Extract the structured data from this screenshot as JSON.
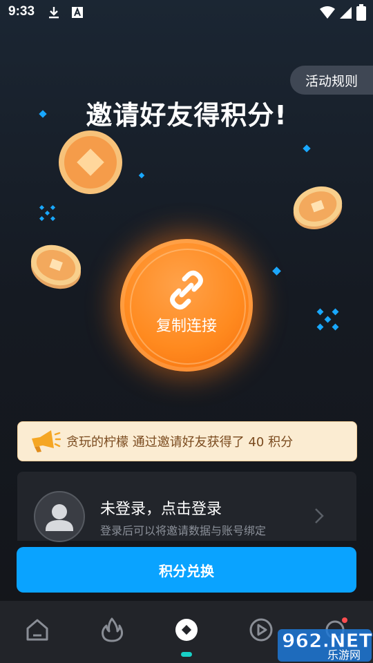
{
  "status_bar": {
    "time": "9:33"
  },
  "page": {
    "rules_label": "活动规则",
    "headline": "邀请好友得积分!",
    "copy_button_label": "复制连接"
  },
  "notice": {
    "text": "贪玩的柠檬 通过邀请好友获得了 40 积分"
  },
  "login": {
    "title": "未登录，点击登录",
    "subtitle": "登录后可以将邀请数据与账号绑定"
  },
  "redeem": {
    "label": "积分兑换"
  },
  "bottom_nav": {
    "items": [
      "home-icon",
      "fire-icon",
      "invite-icon",
      "play-icon",
      "profile-icon"
    ],
    "active_index": 2
  },
  "watermark": {
    "line1": "962.NET",
    "line2": "乐游网"
  },
  "colors": {
    "accent_blue": "#0aa3ff",
    "orange": "#ff8a1f",
    "indicator_teal": "#18d0c6"
  }
}
